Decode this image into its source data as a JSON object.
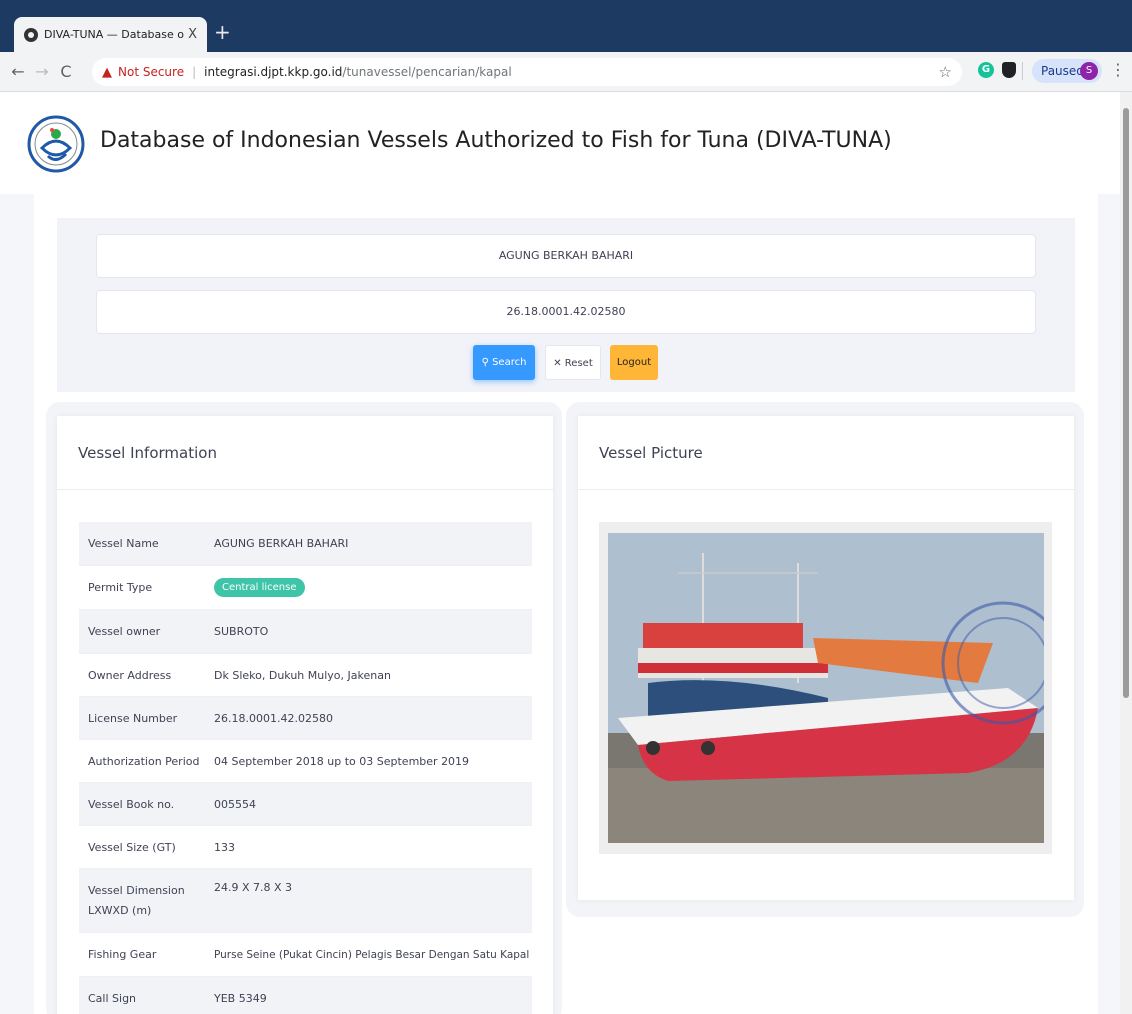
{
  "browser": {
    "tab_title": "DIVA-TUNA — Database of Ind",
    "tab_close": "X",
    "new_tab": "+",
    "nav": {
      "back": "←",
      "forward": "→",
      "reload": "C"
    },
    "security_icon": "warning-icon",
    "not_secure": "Not Secure",
    "separator": "|",
    "url_host": "integrasi.djpt.kkp.go.id",
    "url_path": "/tunavessel/pencarian/kapal",
    "bookmark_icon": "☆",
    "ext_grammarly": "G",
    "paused_label": "Paused",
    "profile_initial": "S",
    "menu_icon": "⋮"
  },
  "header": {
    "title": "Database of Indonesian Vessels Authorized to Fish for Tuna (DIVA-TUNA)"
  },
  "search": {
    "vessel_name_value": "AGUNG BERKAH BAHARI",
    "license_value": "26.18.0001.42.02580",
    "search_label": "⚲ Search",
    "reset_label": "✕ Reset",
    "logout_label": "Logout",
    "colors": {
      "search": "#3699ff",
      "logout": "#ffb636"
    }
  },
  "vessel_info": {
    "heading": "Vessel Information",
    "rows": [
      {
        "key": "Vessel Name",
        "value": "AGUNG BERKAH BAHARI"
      },
      {
        "key": "Permit Type",
        "value": "Central license"
      },
      {
        "key": "Vessel owner",
        "value": "SUBROTO"
      },
      {
        "key": "Owner Address",
        "value": "Dk Sleko, Dukuh Mulyo, Jakenan"
      },
      {
        "key": "License Number",
        "value": "26.18.0001.42.02580"
      },
      {
        "key": "Authorization Period",
        "value": "04 September 2018 up to 03 September 2019"
      },
      {
        "key": "Vessel Book no.",
        "value": "005554"
      },
      {
        "key": "Vessel Size (GT)",
        "value": "133"
      },
      {
        "key": "Vessel Dimension LXWXD (m)",
        "value": "24.9 X 7.8 X 3"
      },
      {
        "key": "Fishing Gear",
        "value": "Purse Seine (Pukat Cincin) Pelagis Besar Dengan Satu Kapal"
      },
      {
        "key": "Call Sign",
        "value": "YEB 5349"
      }
    ],
    "badge_color": "#3ec4a6"
  },
  "vessel_picture": {
    "heading": "Vessel Picture"
  }
}
